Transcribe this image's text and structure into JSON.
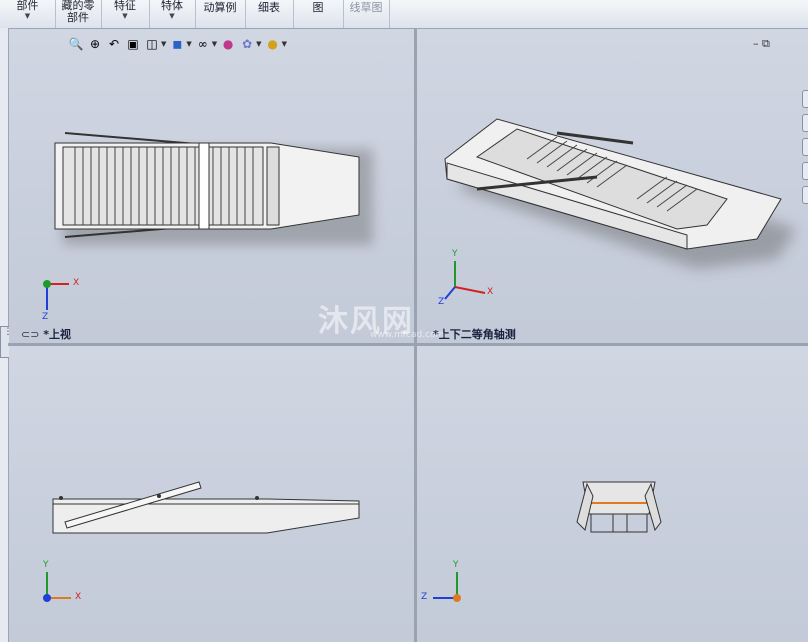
{
  "toolbar": {
    "items": [
      {
        "label1": "部件",
        "label2": "",
        "has_menu": true
      },
      {
        "label1": "藏的零",
        "label2": "部件",
        "has_menu": false
      },
      {
        "label1": "特征",
        "label2": "",
        "has_menu": true
      },
      {
        "label1": "特体",
        "label2": "",
        "has_menu": true
      },
      {
        "label1": "动算例",
        "label2": "",
        "has_menu": false
      },
      {
        "label1": "细表",
        "label2": "",
        "has_menu": false
      },
      {
        "label1": "图",
        "label2": "",
        "has_menu": false
      },
      {
        "label1": "线草图",
        "label2": "",
        "has_menu": false
      }
    ]
  },
  "heads_up_toolbar": [
    "zoom-to-fit-icon",
    "zoom-area-icon",
    "previous-view-icon",
    "section-view-icon",
    "view-orientation-icon",
    "display-style-icon",
    "hide-show-icon",
    "edit-appearance-icon",
    "apply-scene-icon",
    "view-settings-icon"
  ],
  "viewports": {
    "top_left": {
      "label": "*上视"
    },
    "top_right": {
      "label": "*上下二等角轴测"
    },
    "bottom_left": {
      "label": ""
    },
    "bottom_right": {
      "label": ""
    }
  },
  "triad": {
    "x": "X",
    "y": "Y",
    "z": "Z"
  },
  "watermark": {
    "text": "沐风网",
    "sub": "www.mfcad.com"
  },
  "colors": {
    "x_axis": "#d42020",
    "y_axis": "#1f9a2a",
    "z_axis": "#1f3fd8",
    "model_fill": "#f2f2f2",
    "model_edge": "#333333"
  }
}
